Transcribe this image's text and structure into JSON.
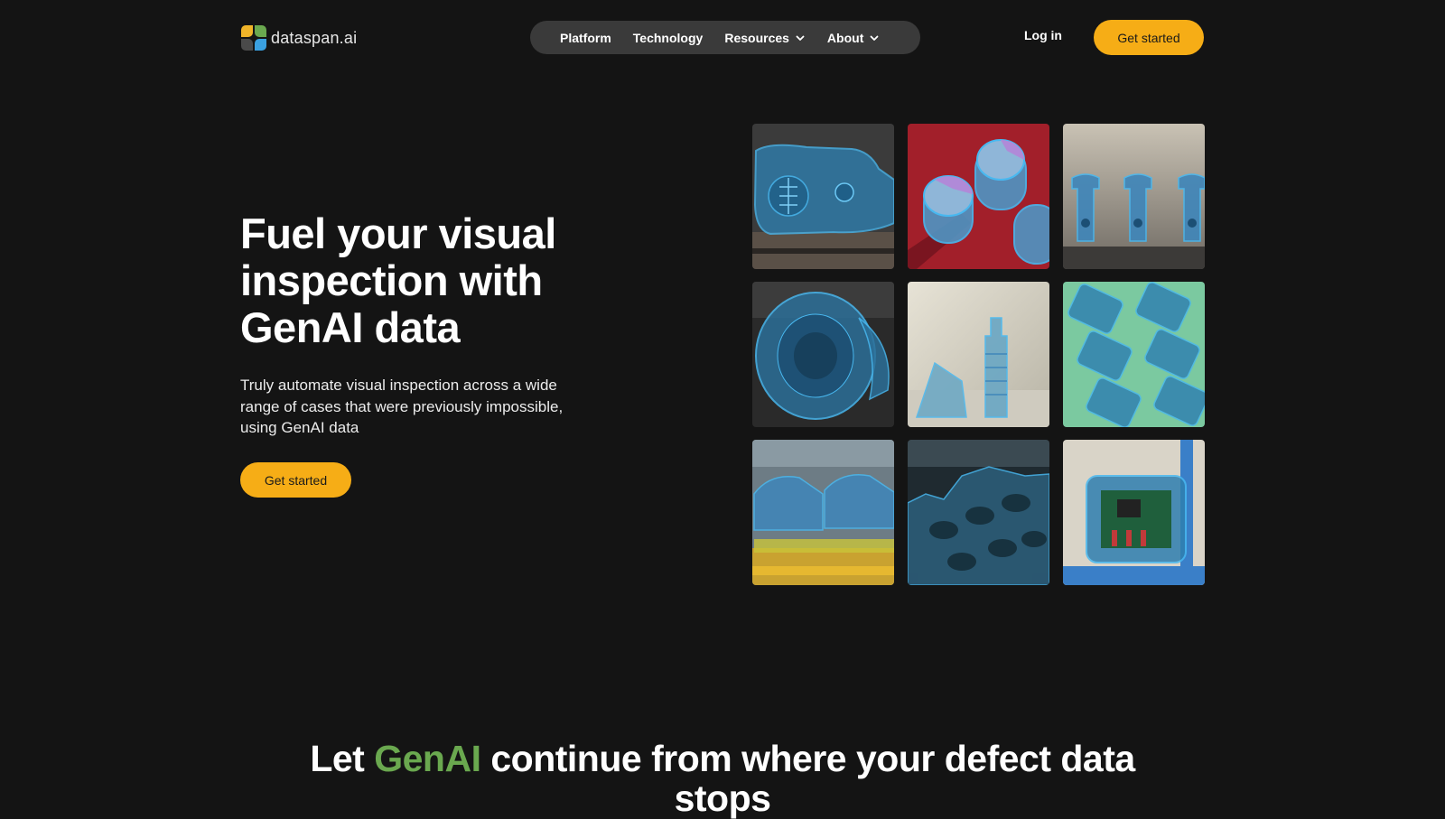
{
  "header": {
    "logo_text": "dataspan.ai",
    "nav": {
      "platform": "Platform",
      "technology": "Technology",
      "resources": "Resources",
      "about": "About"
    },
    "login": "Log in",
    "cta": "Get started"
  },
  "hero": {
    "title": "Fuel your visual inspection with GenAI data",
    "description": "Truly automate visual inspection across a wide range of cases that were previously impossible, using GenAI data",
    "cta": "Get started"
  },
  "section": {
    "title_prefix": "Let ",
    "title_accent": "GenAI",
    "title_suffix": " continue from where your defect data stops"
  },
  "colors": {
    "background": "#141414",
    "accent_button": "#f6ad16",
    "accent_green": "#6aa84f",
    "nav_pill": "#3a3a3a",
    "segmentation_overlay": "#3aa0e0"
  },
  "icons": {
    "logo": "four-petal-logo-icon",
    "dropdown": "chevron-down-icon"
  }
}
